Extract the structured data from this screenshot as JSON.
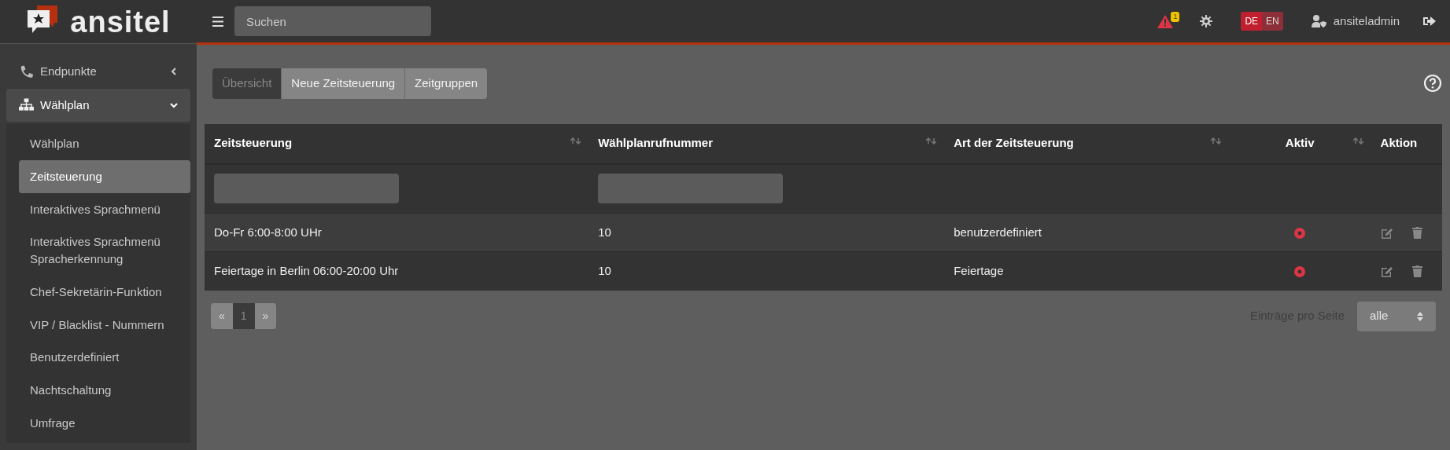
{
  "brand": {
    "name": "ansitel"
  },
  "topbar": {
    "search": {
      "placeholder": "Suchen"
    },
    "alert_count": "1",
    "languages": [
      {
        "label": "DE",
        "selected": true
      },
      {
        "label": "EN",
        "selected": false
      }
    ],
    "user": "ansiteladmin"
  },
  "sidebar": {
    "items": [
      {
        "label": "Endpunkte",
        "expanded": false
      },
      {
        "label": "Wählplan",
        "expanded": true,
        "children": [
          {
            "label": "Wählplan",
            "selected": false
          },
          {
            "label": "Zeitsteuerung",
            "selected": true
          },
          {
            "label": "Interaktives Sprachmenü",
            "selected": false
          },
          {
            "label": "Interaktives Sprachmenü Spracherkennung",
            "selected": false
          },
          {
            "label": "Chef-Sekretärin-Funktion",
            "selected": false
          },
          {
            "label": "VIP / Blacklist - Nummern",
            "selected": false
          },
          {
            "label": "Benutzerdefiniert",
            "selected": false
          },
          {
            "label": "Nachtschaltung",
            "selected": false
          },
          {
            "label": "Umfrage",
            "selected": false
          }
        ]
      }
    ]
  },
  "tabs": [
    {
      "label": "Übersicht",
      "selected": true
    },
    {
      "label": "Neue Zeitsteuerung",
      "selected": false
    },
    {
      "label": "Zeitgruppen",
      "selected": false
    }
  ],
  "table": {
    "columns": [
      {
        "label": "Zeitsteuerung",
        "filter": true
      },
      {
        "label": "Wählplanrufnummer",
        "filter": true
      },
      {
        "label": "Art der Zeitsteuerung",
        "filter": false
      },
      {
        "label": "Aktiv",
        "filter": false
      },
      {
        "label": "Aktion",
        "filter": false
      }
    ],
    "rows": [
      {
        "name": "Do-Fr 6:00-8:00 UHr",
        "number": "10",
        "type": "benutzerdefiniert",
        "active": false
      },
      {
        "name": "Feiertage in Berlin 06:00-20:00 Uhr",
        "number": "10",
        "type": "Feiertage",
        "active": false
      }
    ]
  },
  "pagination": {
    "pages": [
      {
        "label": "«",
        "selected": false
      },
      {
        "label": "1",
        "selected": true
      },
      {
        "label": "»",
        "selected": false
      }
    ]
  },
  "page_size": {
    "label": "Einträge pro Seite",
    "value": "alle"
  }
}
